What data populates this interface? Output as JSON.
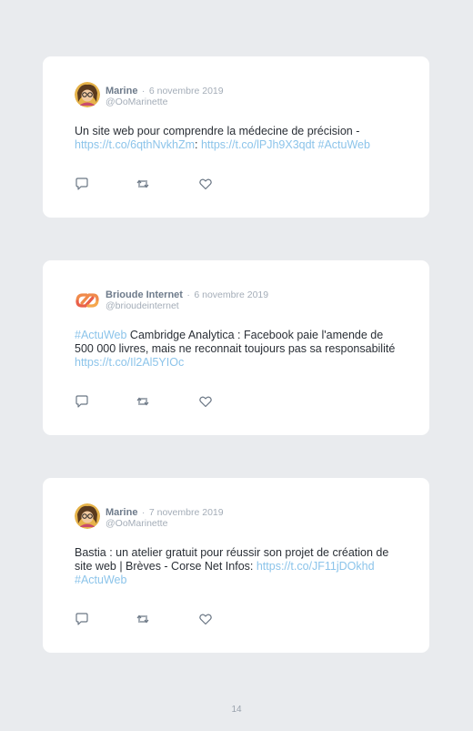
{
  "tweets": [
    {
      "name": "Marine",
      "separator": "·",
      "date": "6 novembre 2019",
      "handle": "@OoMarinette",
      "segments": [
        {
          "text": "Un site web pour comprendre la médecine de précision - ",
          "link": false
        },
        {
          "text": "https://t.co/6qthNvkhZm",
          "link": true
        },
        {
          "text": ": ",
          "link": false
        },
        {
          "text": "https://t.co/lPJh9X3qdt",
          "link": true
        },
        {
          "text": " ",
          "link": false
        },
        {
          "text": "#ActuWeb",
          "link": true
        }
      ],
      "avatar_icon": "avatar-marine"
    },
    {
      "name": "Brioude Internet",
      "separator": "·",
      "date": "6 novembre 2019",
      "handle": "@brioudeinternet",
      "segments": [
        {
          "text": "#ActuWeb",
          "link": true
        },
        {
          "text": " Cambridge Analytica : Facebook paie l'amende de 500 000 livres, mais ne reconnait toujours pas sa responsabilité ",
          "link": false
        },
        {
          "text": "https://t.co/Il2Al5YIOc",
          "link": true
        }
      ],
      "avatar_icon": "brioude-logo"
    },
    {
      "name": "Marine",
      "separator": "·",
      "date": "7 novembre 2019",
      "handle": "@OoMarinette",
      "segments": [
        {
          "text": "Bastia : un atelier gratuit pour réussir son projet de création de site web | Brèves - Corse Net Infos: ",
          "link": false
        },
        {
          "text": "https://t.co/JF11jDOkhd",
          "link": true
        },
        {
          "text": " ",
          "link": false
        },
        {
          "text": "#ActuWeb",
          "link": true
        }
      ],
      "avatar_icon": "avatar-marine"
    }
  ],
  "action_icons": [
    "reply-icon",
    "retweet-icon",
    "like-icon"
  ],
  "page_number": "14",
  "colors": {
    "background": "#e9ebee",
    "card": "#ffffff",
    "link": "#8cc4ea",
    "name": "#6e7b8b",
    "muted": "#a4adb8",
    "text": "#2a2f36"
  }
}
